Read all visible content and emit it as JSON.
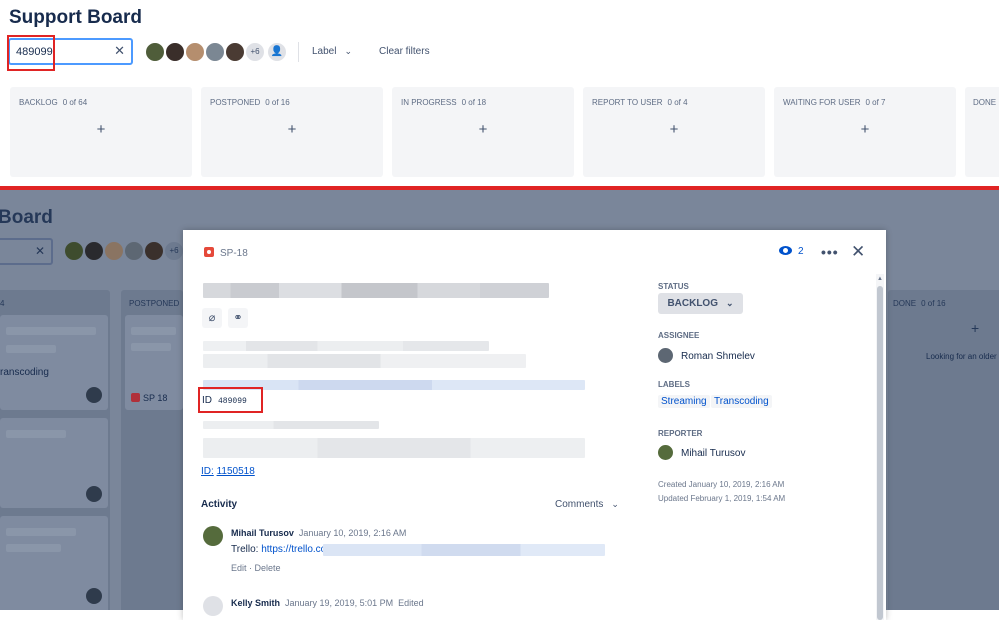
{
  "board": {
    "title": "Support Board",
    "search_value": "489099",
    "more_avatars": "+6",
    "label_filter": "Label",
    "clear_filters": "Clear filters"
  },
  "columns": [
    {
      "name": "BACKLOG",
      "count": "0 of 64"
    },
    {
      "name": "POSTPONED",
      "count": "0 of 16"
    },
    {
      "name": "IN PROGRESS",
      "count": "0 of 18"
    },
    {
      "name": "REPORT TO USER",
      "count": "0 of 4"
    },
    {
      "name": "WAITING FOR USER",
      "count": "0 of 7"
    },
    {
      "name": "DONE",
      "count": ""
    }
  ],
  "background_board": {
    "title": "Board",
    "more_avatars": "+6",
    "col_backlog_count": "4",
    "col_postponed": "POSTPONED",
    "col_done": "DONE",
    "col_done_count": "0 of 16",
    "card_text": "ranscoding",
    "card_key": "SP 18",
    "done_hint": "Looking for an older"
  },
  "modal": {
    "issue_key": "SP-18",
    "watchers": "2",
    "id_label": "ID",
    "id_value": "489099",
    "id_link_label": "ID:",
    "id_link_value": "1150518",
    "activity_label": "Activity",
    "comments_select": "Comments",
    "comments": [
      {
        "author": "Mihail Turusov",
        "date": "January 10, 2019, 2:16 AM",
        "body_prefix": "Trello:",
        "body_link": "https://trello.co",
        "edit": "Edit",
        "delete": "Delete"
      },
      {
        "author": "Kelly Smith",
        "date": "January 19, 2019, 5:01 PM",
        "edited": "Edited"
      }
    ],
    "sidebar": {
      "status_label": "STATUS",
      "status_value": "BACKLOG",
      "assignee_label": "ASSIGNEE",
      "assignee": "Roman Shmelev",
      "labels_label": "LABELS",
      "labels": [
        "Streaming",
        "Transcoding"
      ],
      "reporter_label": "REPORTER",
      "reporter": "Mihail Turusov",
      "created": "Created January 10, 2019, 2:16 AM",
      "updated": "Updated February 1, 2019, 1:54 AM"
    }
  },
  "colors": {
    "accent": "#0052cc",
    "highlight": "#e02424",
    "bug": "#e5493a"
  }
}
